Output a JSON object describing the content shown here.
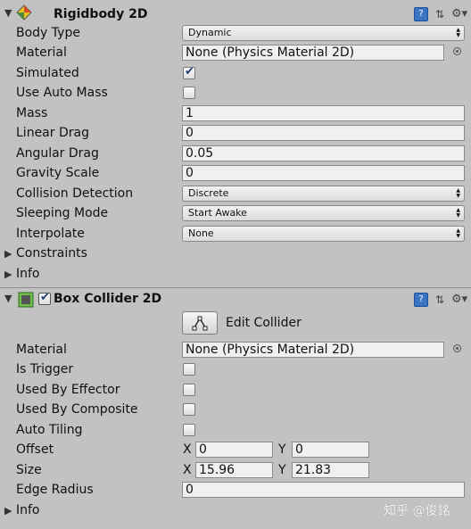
{
  "rigidbody": {
    "title": "Rigidbody 2D",
    "fields": {
      "body_type": {
        "label": "Body Type",
        "value": "Dynamic"
      },
      "material": {
        "label": "Material",
        "value": "None (Physics Material 2D)"
      },
      "simulated": {
        "label": "Simulated",
        "checked": true
      },
      "use_auto_mass": {
        "label": "Use Auto Mass",
        "checked": false
      },
      "mass": {
        "label": "Mass",
        "value": "1"
      },
      "linear_drag": {
        "label": "Linear Drag",
        "value": "0"
      },
      "angular_drag": {
        "label": "Angular Drag",
        "value": "0.05"
      },
      "gravity_scale": {
        "label": "Gravity Scale",
        "value": "0"
      },
      "collision_detection": {
        "label": "Collision Detection",
        "value": "Discrete"
      },
      "sleeping_mode": {
        "label": "Sleeping Mode",
        "value": "Start Awake"
      },
      "interpolate": {
        "label": "Interpolate",
        "value": "None"
      }
    },
    "constraints_label": "Constraints",
    "info_label": "Info"
  },
  "box_collider": {
    "title": "Box Collider 2D",
    "enabled": true,
    "edit_collider_label": "Edit Collider",
    "fields": {
      "material": {
        "label": "Material",
        "value": "None (Physics Material 2D)"
      },
      "is_trigger": {
        "label": "Is Trigger",
        "checked": false
      },
      "used_by_effector": {
        "label": "Used By Effector",
        "checked": false
      },
      "used_by_composite": {
        "label": "Used By Composite",
        "checked": false
      },
      "auto_tiling": {
        "label": "Auto Tiling",
        "checked": false
      },
      "offset": {
        "label": "Offset",
        "x_label": "X",
        "x": "0",
        "y_label": "Y",
        "y": "0"
      },
      "size": {
        "label": "Size",
        "x_label": "X",
        "x": "15.96",
        "y_label": "Y",
        "y": "21.83"
      },
      "edge_radius": {
        "label": "Edge Radius",
        "value": "0"
      }
    },
    "info_label": "Info"
  },
  "watermark": "知乎 @俊銘",
  "icons": {
    "help": "help-icon",
    "presets": "presets-icon",
    "settings": "gear-icon"
  }
}
